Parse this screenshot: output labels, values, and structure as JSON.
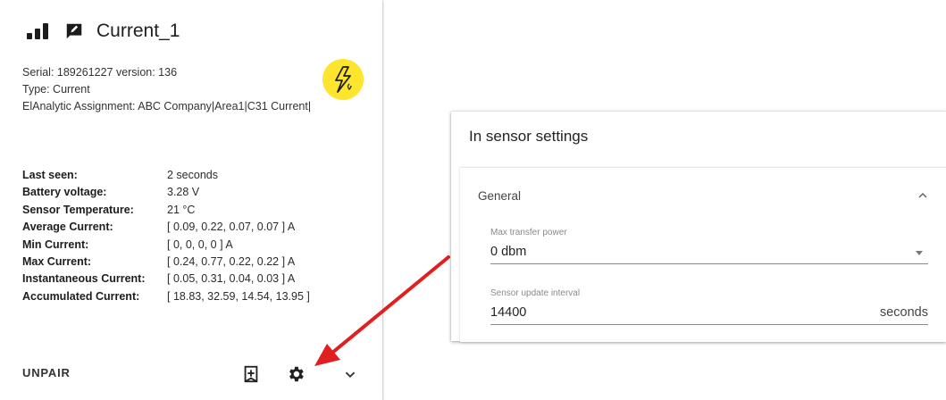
{
  "card": {
    "title": "Current_1",
    "serial_line": "Serial: 189261227 version: 136",
    "type_line": "Type: Current",
    "assignment_line": "ElAnalytic Assignment: ABC Company|Area1|C31 Current|",
    "badge_icon": "lightning-bolt-icon",
    "badge_color": "#fde52e",
    "stats": [
      {
        "label": "Last seen:",
        "value": "2 seconds"
      },
      {
        "label": "Battery voltage:",
        "value": "3.28 V"
      },
      {
        "label": "Sensor Temperature:",
        "value": "21 °C"
      },
      {
        "label": "Average Current:",
        "value": "[ 0.09, 0.22, 0.07, 0.07 ] A"
      },
      {
        "label": "Min Current:",
        "value": "[ 0, 0, 0, 0 ] A"
      },
      {
        "label": "Max Current:",
        "value": "[ 0.24, 0.77, 0.22, 0.22 ] A"
      },
      {
        "label": "Instantaneous Current:",
        "value": "[ 0.05, 0.31, 0.04, 0.03 ] A"
      },
      {
        "label": "Accumulated Current:",
        "value": "[ 18.83, 32.59, 14.54, 13.95 ]"
      }
    ],
    "footer": {
      "unpair_label": "UNPAIR",
      "icons": [
        "bookmark-add-icon",
        "gear-icon",
        "chevron-down-icon"
      ]
    }
  },
  "annotation": {
    "arrow_color": "#e02020"
  },
  "settings": {
    "title": "In sensor settings",
    "section_label": "General",
    "fields": [
      {
        "label": "Max transfer power",
        "value": "0 dbm",
        "kind": "select"
      },
      {
        "label": "Sensor update interval",
        "value": "14400",
        "suffix": "seconds",
        "kind": "number"
      }
    ]
  }
}
